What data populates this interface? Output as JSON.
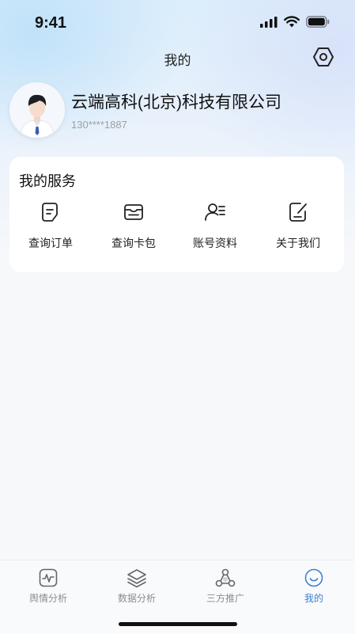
{
  "status_bar": {
    "time": "9:41",
    "icons": [
      "signal-icon",
      "wifi-icon",
      "battery-icon"
    ]
  },
  "header": {
    "title": "我的",
    "settings_icon": "settings-hexagon-icon"
  },
  "profile": {
    "avatar_icon": "user-avatar",
    "company_name": "云端高科(北京)科技有限公司",
    "phone": "130****1887"
  },
  "services": {
    "title": "我的服务",
    "items": [
      {
        "label": "查询订单",
        "icon": "order-document-icon"
      },
      {
        "label": "查询卡包",
        "icon": "wallet-icon"
      },
      {
        "label": "账号资料",
        "icon": "account-profile-icon"
      },
      {
        "label": "关于我们",
        "icon": "edit-document-icon"
      }
    ]
  },
  "tabbar": {
    "active_color": "#3f7fd8",
    "inactive_color": "#8c8c8c",
    "items": [
      {
        "label": "舆情分析",
        "icon": "pulse-chart-icon",
        "active": false
      },
      {
        "label": "数据分析",
        "icon": "layers-icon",
        "active": false
      },
      {
        "label": "三方推广",
        "icon": "network-share-icon",
        "active": false
      },
      {
        "label": "我的",
        "icon": "smile-icon",
        "active": true
      }
    ]
  }
}
